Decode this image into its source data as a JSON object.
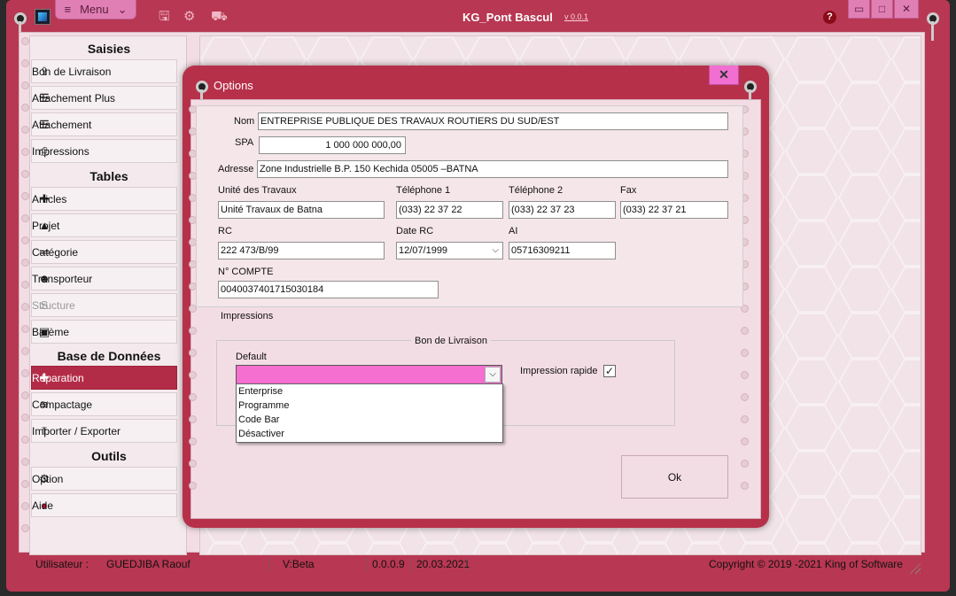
{
  "app": {
    "title": "KG_Pont Bascul",
    "version": "v 0.0.1",
    "menu_label": "Menu",
    "window_controls": {
      "minimize": "▭",
      "maximize": "□",
      "close": "✕"
    }
  },
  "sidebar": {
    "sections": [
      {
        "title": "Saisies",
        "items": [
          {
            "label": "Bon de Livraison",
            "icon": "share-icon"
          },
          {
            "label": "Attachement Plus",
            "icon": "list-icon"
          },
          {
            "label": "Attachement",
            "icon": "list-icon"
          },
          {
            "label": "Impressions",
            "icon": "printer-icon"
          }
        ]
      },
      {
        "title": "Tables",
        "items": [
          {
            "label": "Articles",
            "icon": "puzzle-icon"
          },
          {
            "label": "Projet",
            "icon": "road-icon"
          },
          {
            "label": "Catégorie",
            "icon": "list-ol-icon"
          },
          {
            "label": "Transporteur",
            "icon": "users-icon"
          },
          {
            "label": "Structure",
            "icon": "structure-icon",
            "disabled": true
          },
          {
            "label": "Barème",
            "icon": "money-icon"
          }
        ]
      },
      {
        "title": "Base de Données",
        "items": [
          {
            "label": "Réparation",
            "icon": "medkit-icon",
            "active": true
          },
          {
            "label": "Compactage",
            "icon": "stack-icon"
          },
          {
            "label": "Importer  / Exporter",
            "icon": "upload-icon"
          }
        ]
      },
      {
        "title": "Outils",
        "items": [
          {
            "label": "Option",
            "icon": "gears-icon"
          },
          {
            "label": "Aide",
            "icon": "help-icon"
          }
        ]
      }
    ]
  },
  "dialog": {
    "title": "Options",
    "close": "✕",
    "nom_label": "Nom",
    "nom_value": "ENTREPRISE PUBLIQUE DES TRAVAUX ROUTIERS DU SUD/EST",
    "spa_label": "SPA",
    "spa_value": "1 000 000 000,00",
    "adresse_label": "Adresse",
    "adresse_value": "Zone Industrielle B.P. 150 Kechida 05005 –BATNA",
    "unite_label": "Unité des Travaux",
    "unite_value": "Unité Travaux de Batna",
    "tel1_label": "Téléphone 1",
    "tel1_value": "(033) 22 37 22",
    "tel2_label": "Téléphone 2",
    "tel2_value": "(033) 22 37 23",
    "fax_label": "Fax",
    "fax_value": "(033) 22 37 21",
    "rc_label": "RC",
    "rc_value": "222 473/B/99",
    "daterc_label": "Date RC",
    "daterc_value": "12/07/1999",
    "ai_label": "AI",
    "ai_value": "05716309211",
    "compte_label": "N° COMPTE",
    "compte_value": "004003740171503018​4",
    "impressions_label": "Impressions",
    "group_title": "Bon de Livraison",
    "default_label": "Default",
    "default_options": [
      "Enterprise",
      "Programme",
      "Code Bar",
      "Désactiver"
    ],
    "impression_rapide_label": "Impression rapide",
    "impression_rapide_checked": true,
    "ok_label": "Ok"
  },
  "status": {
    "user_label": "Utilisateur :",
    "user_name": "GUEDJIBA Raouf",
    "version": "V:Beta",
    "build": "0.0.0.9",
    "date": "20.03.2021",
    "copyright": "Copyright © 2019 -2021 King of Software"
  },
  "colors": {
    "accent": "#b83752",
    "panel": "#f3dde4",
    "combo": "#f56fd0",
    "active_item": "#b32c47"
  }
}
